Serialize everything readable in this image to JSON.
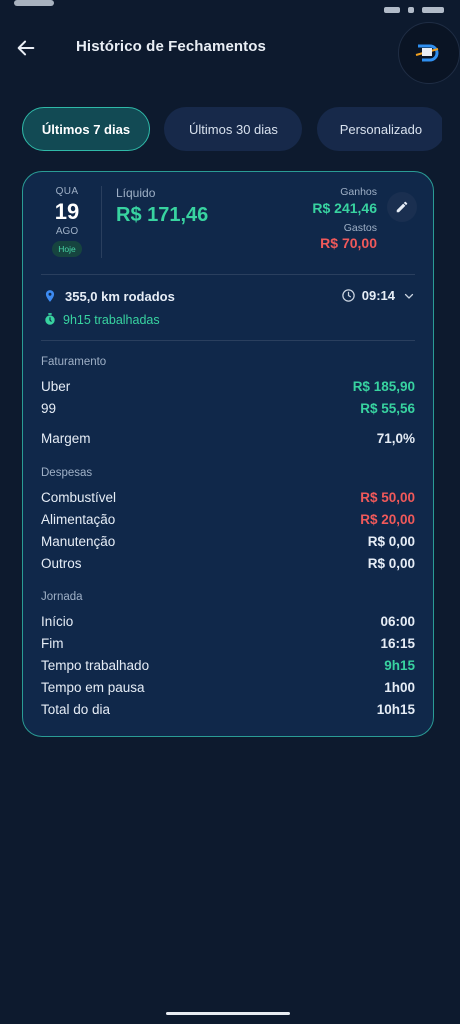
{
  "header": {
    "title": "Histórico de Fechamentos"
  },
  "filters": [
    {
      "label": "Últimos 7 dias",
      "active": true
    },
    {
      "label": "Últimos 30 dias",
      "active": false
    },
    {
      "label": "Personalizado",
      "active": false
    }
  ],
  "card": {
    "date": {
      "weekday": "QUA",
      "day": "19",
      "month": "AGO",
      "badge": "Hoje"
    },
    "liquido": {
      "label": "Líquido",
      "value": "R$ 171,46"
    },
    "ganhos": {
      "label": "Ganhos",
      "value": "R$ 241,46"
    },
    "gastos": {
      "label": "Gastos",
      "value": "R$ 70,00"
    },
    "km": "355,0 km rodados",
    "time": "09:14",
    "worked": "9h15 trabalhadas",
    "faturamento": {
      "title": "Faturamento",
      "items": [
        {
          "label": "Uber",
          "value": "R$ 185,90"
        },
        {
          "label": "99",
          "value": "R$ 55,56"
        }
      ],
      "margem": {
        "label": "Margem",
        "value": "71,0%"
      }
    },
    "despesas": {
      "title": "Despesas",
      "items": [
        {
          "label": "Combustível",
          "value": "R$ 50,00"
        },
        {
          "label": "Alimentação",
          "value": "R$ 20,00"
        },
        {
          "label": "Manutenção",
          "value": "R$ 0,00"
        },
        {
          "label": "Outros",
          "value": "R$ 0,00"
        }
      ]
    },
    "jornada": {
      "title": "Jornada",
      "items": [
        {
          "label": "Início",
          "value": "06:00"
        },
        {
          "label": "Fim",
          "value": "16:15"
        },
        {
          "label": "Tempo trabalhado",
          "value": "9h15"
        },
        {
          "label": "Tempo em pausa",
          "value": "1h00"
        },
        {
          "label": "Total do dia",
          "value": "10h15"
        }
      ]
    }
  },
  "colors": {
    "background": "#0d1a2e",
    "card": "#10284a",
    "accent": "#38d3a0",
    "danger": "#f0595a",
    "border": "#2a9c95"
  },
  "icons": [
    "back-arrow-icon",
    "avatar-logo-icon",
    "edit-pencil-icon",
    "location-pin-icon",
    "clock-icon",
    "chevron-down-icon",
    "timer-icon"
  ]
}
